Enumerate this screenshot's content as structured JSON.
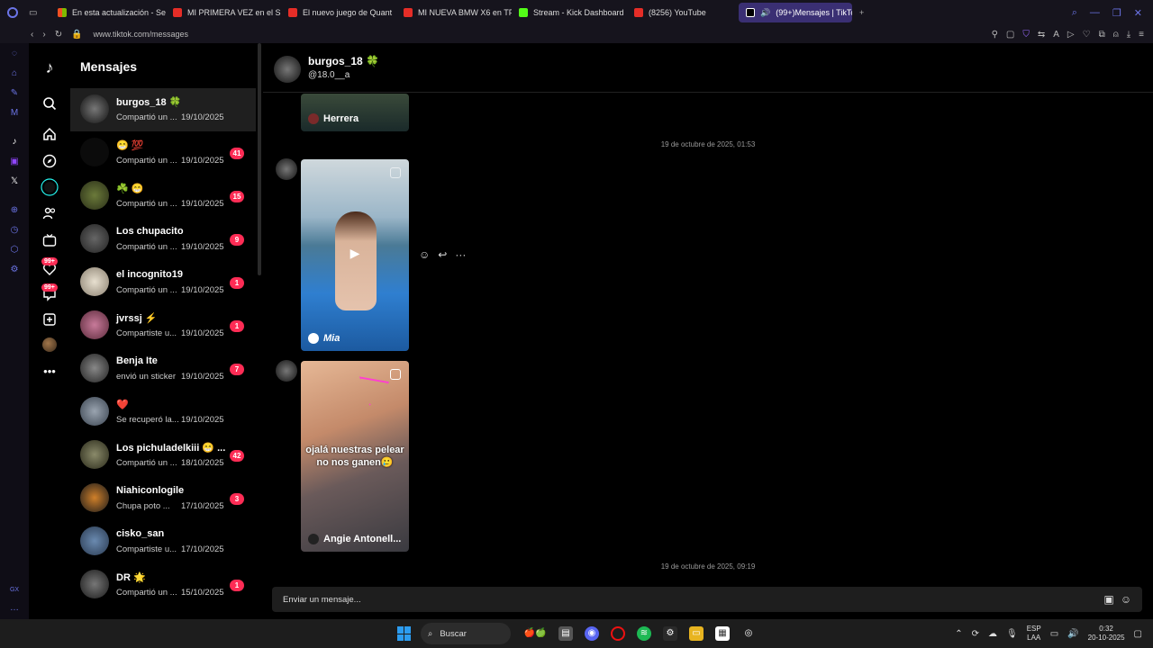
{
  "browser": {
    "tabs": [
      {
        "title": "En esta actualización - Se",
        "color": "#2aa64a"
      },
      {
        "title": "MI PRIMERA VEZ en el SE",
        "color": "#e52d27"
      },
      {
        "title": "El nuevo juego de Quant",
        "color": "#e52d27"
      },
      {
        "title": "MI NUEVA BMW X6 en TF",
        "color": "#e52d27"
      },
      {
        "title": "Stream - Kick Dashboard",
        "color": "#53fc18"
      },
      {
        "title": "(8256) YouTube",
        "color": "#e52d27"
      },
      {
        "title": "(99+)Mensajes | TikTo",
        "color": "#ffffff"
      }
    ],
    "url": "www.tiktok.com/messages"
  },
  "tiktok": {
    "messages_title": "Mensajes",
    "nav_badge_1": "99+",
    "nav_badge_2": "99+"
  },
  "conversations": [
    {
      "name": "burgos_18 🍀",
      "preview": "Compartió un ...",
      "date": "19/10/2025",
      "count": "",
      "active": true
    },
    {
      "name": "😁 💯",
      "preview": "Compartió un ...",
      "date": "19/10/2025",
      "count": "41"
    },
    {
      "name": "☘️ 😁",
      "preview": "Compartió un ...",
      "date": "19/10/2025",
      "count": "15"
    },
    {
      "name": "Los chupacito",
      "preview": "Compartió un ...",
      "date": "19/10/2025",
      "count": "9"
    },
    {
      "name": "el incognito19",
      "preview": "Compartió un ...",
      "date": "19/10/2025",
      "count": "1"
    },
    {
      "name": "jvrssj ⚡",
      "preview": "Compartiste u...",
      "date": "19/10/2025",
      "count": "1"
    },
    {
      "name": "Benja Ite",
      "preview": "envió un sticker",
      "date": "19/10/2025",
      "count": "7"
    },
    {
      "name": "❤️",
      "preview": "Se recuperó la...",
      "date": "19/10/2025",
      "count": ""
    },
    {
      "name": "Los pichuladelkiii 😁 ...",
      "preview": "Compartió un ...",
      "date": "18/10/2025",
      "count": "42"
    },
    {
      "name": "Niahiconlogile",
      "preview": "Chupa poto ...",
      "date": "17/10/2025",
      "count": "3"
    },
    {
      "name": "cisko_san",
      "preview": "Compartiste u...",
      "date": "17/10/2025",
      "count": ""
    },
    {
      "name": "DR 🌟",
      "preview": "Compartió un ...",
      "date": "15/10/2025",
      "count": "1"
    }
  ],
  "chat": {
    "name": "burgos_18 🍀",
    "username": "@18.0__a",
    "cards": [
      {
        "label": "Herrera"
      },
      {
        "label": "Mia"
      },
      {
        "label": "Angie Antonell...",
        "caption": "ojalá nuestras pelear no nos ganen🥲"
      }
    ],
    "timestamps": [
      "19 de octubre de 2025, 01:53",
      "19 de octubre de 2025, 09:19"
    ],
    "input_placeholder": "Enviar un mensaje..."
  },
  "taskbar": {
    "search_label": "Buscar",
    "lang_top": "ESP",
    "lang_bottom": "LAA",
    "time": "0:32",
    "date": "20-10-2025"
  },
  "icons": [
    "opera-logo-icon",
    "tiktok-logo-icon",
    "search-icon",
    "home-icon",
    "explore-icon",
    "users-icon",
    "live-icon",
    "inbox-icon",
    "upload-icon",
    "more-icon",
    "emoji-react-icon",
    "reply-icon",
    "ellipsis-icon",
    "image-icon",
    "emoji-icon",
    "windows-start-icon"
  ]
}
